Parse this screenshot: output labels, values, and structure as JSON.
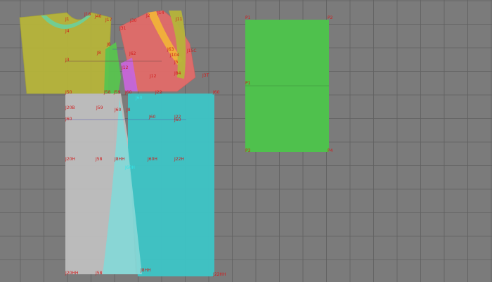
{
  "viewport": {
    "grid_color": "#606060",
    "background": "#7b7b7b"
  },
  "colors": {
    "yellow_piece": "#b6b43a",
    "green_collar": "#6fcf98",
    "red_piece": "#e26c6a",
    "orange_band": "#f0b23a",
    "magenta_piece": "#c766d9",
    "green_small": "#58c44f",
    "cyan_piece": "#3ec3c4",
    "gray_piece": "#bdbdbd",
    "light_cyan_strip": "#86d7d6",
    "green_rect": "#4fc34c",
    "label_red": "#d11a1a",
    "label_cyan": "#32e6ea"
  },
  "labels": {
    "p1": "P1",
    "p2": "P2",
    "p3": "P3",
    "p4": "P4",
    "p_mid": "P1",
    "j1": "J1",
    "j4": "J4",
    "j8": "J8",
    "j12": "J12",
    "j3": "J3",
    "j5": "J5",
    "j60": "J60",
    "j20h": "J20H",
    "j20b": "J20B",
    "j60b": "J60",
    "j59": "J59",
    "j8b": "J8",
    "j50": "J50",
    "j58": "J58",
    "j15c": "J15C",
    "j3t": "J3T",
    "j12b": "J12",
    "j22": "J22",
    "j60c": "J60",
    "j20hh": "J20HH",
    "j58b": "J58",
    "j8hh": "J8HH",
    "j22h": "J22H",
    "j22hh": "J22HH",
    "j60h": "J60H",
    "j16": "J16",
    "j40": "J40",
    "j30": "J30",
    "j31": "J31",
    "j2": "J2",
    "j14": "J14",
    "j17": "J17",
    "j11": "J11",
    "j104": "J104",
    "j84": "J84",
    "j63": "J63",
    "j62": "J62"
  }
}
